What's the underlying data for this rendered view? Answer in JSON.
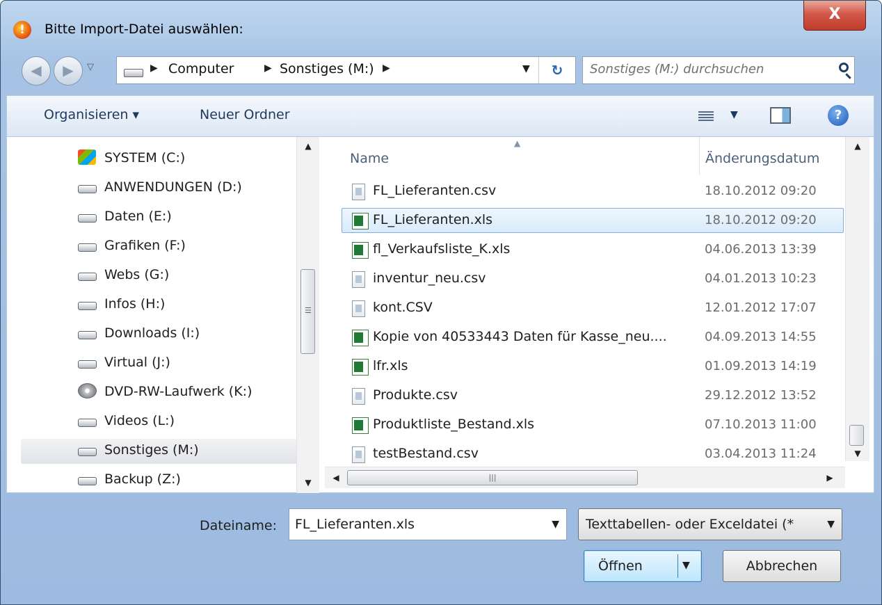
{
  "window": {
    "title": "Bitte Import-Datei auswählen:",
    "close_label": "X"
  },
  "navigation": {
    "path": [
      "Computer",
      "Sonstiges (M:)"
    ],
    "search_placeholder": "Sonstiges (M:) durchsuchen"
  },
  "toolbar": {
    "organize_label": "Organisieren ▾",
    "new_folder_label": "Neuer Ordner"
  },
  "sidebar": {
    "items": [
      {
        "label": "SYSTEM (C:)",
        "icon": "windows-drive-icon"
      },
      {
        "label": "ANWENDUNGEN (D:)",
        "icon": "drive-icon"
      },
      {
        "label": "Daten (E:)",
        "icon": "drive-icon"
      },
      {
        "label": "Grafiken (F:)",
        "icon": "drive-icon"
      },
      {
        "label": "Webs (G:)",
        "icon": "drive-icon"
      },
      {
        "label": "Infos (H:)",
        "icon": "drive-icon"
      },
      {
        "label": "Downloads (I:)",
        "icon": "drive-icon"
      },
      {
        "label": "Virtual (J:)",
        "icon": "drive-icon"
      },
      {
        "label": "DVD-RW-Laufwerk (K:)",
        "icon": "dvd-drive-icon"
      },
      {
        "label": "Videos (L:)",
        "icon": "drive-icon"
      },
      {
        "label": "Sonstiges (M:)",
        "icon": "drive-icon",
        "selected": true
      },
      {
        "label": "Backup (Z:)",
        "icon": "drive-icon"
      }
    ]
  },
  "file_list": {
    "columns": {
      "name": "Name",
      "date": "Änderungsdatum"
    },
    "rows": [
      {
        "name": "FL_Lieferanten.csv",
        "date": "18.10.2012 09:20",
        "type": "csv"
      },
      {
        "name": "FL_Lieferanten.xls",
        "date": "18.10.2012 09:20",
        "type": "xls",
        "selected": true
      },
      {
        "name": "fl_Verkaufsliste_K.xls",
        "date": "04.06.2013 13:39",
        "type": "xls"
      },
      {
        "name": "inventur_neu.csv",
        "date": "04.01.2013 10:23",
        "type": "csv"
      },
      {
        "name": "kont.CSV",
        "date": "12.01.2012 17:07",
        "type": "csv"
      },
      {
        "name": "Kopie von 40533443 Daten für Kasse_neu....",
        "date": "04.09.2013 14:55",
        "type": "xls"
      },
      {
        "name": "lfr.xls",
        "date": "01.09.2013 14:19",
        "type": "xls"
      },
      {
        "name": "Produkte.csv",
        "date": "29.12.2012 13:52",
        "type": "csv"
      },
      {
        "name": "Produktliste_Bestand.xls",
        "date": "07.10.2013 11:00",
        "type": "xls"
      },
      {
        "name": "testBestand.csv",
        "date": "03.04.2013 11:24",
        "type": "csv"
      }
    ]
  },
  "footer": {
    "filename_label": "Dateiname:",
    "filename_value": "FL_Lieferanten.xls",
    "filter_label": "Texttabellen- oder Exceldatei (*",
    "open_label": "Öffnen",
    "cancel_label": "Abbrechen"
  },
  "colors": {
    "selection": "#d8ebfb",
    "selection_border": "#84acdd",
    "window_frame": "#a6c3e5"
  }
}
